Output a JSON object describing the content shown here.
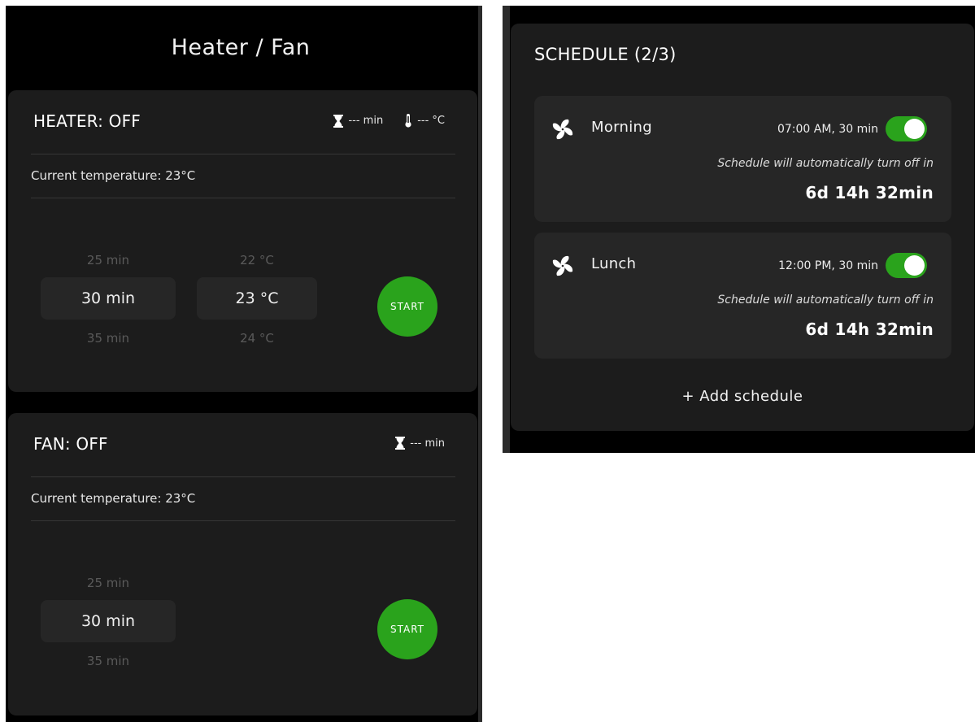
{
  "header": {
    "title": "Heater / Fan"
  },
  "heater": {
    "title": "HEATER: OFF",
    "timer_value": "--- min",
    "temp_value": "--- °C",
    "current_temperature": "Current temperature: 23°C",
    "duration_picker": {
      "prev": "25 min",
      "selected": "30 min",
      "next": "35 min"
    },
    "temperature_picker": {
      "prev": "22 °C",
      "selected": "23 °C",
      "next": "24 °C"
    },
    "start_label": "START"
  },
  "fan": {
    "title": "FAN: OFF",
    "timer_value": "--- min",
    "current_temperature": "Current temperature: 23°C",
    "duration_picker": {
      "prev": "25 min",
      "selected": "30 min",
      "next": "35 min"
    },
    "start_label": "START"
  },
  "schedule": {
    "title": "SCHEDULE (2/3)",
    "items": [
      {
        "name": "Morning",
        "time": "07:00 AM, 30 min",
        "enabled": true,
        "auto_off_text": "Schedule will automatically turn off in",
        "countdown": "6d 14h 32min",
        "icon": "fan-icon"
      },
      {
        "name": "Lunch",
        "time": "12:00 PM, 30 min",
        "enabled": true,
        "auto_off_text": "Schedule will automatically turn off in",
        "countdown": "6d 14h 32min",
        "icon": "fan-icon"
      }
    ],
    "add_label": "+ Add schedule"
  },
  "colors": {
    "background": "#000000",
    "card": "#1c1c1c",
    "accent_green": "#2aa31c",
    "muted_text": "#5a5a5a"
  }
}
